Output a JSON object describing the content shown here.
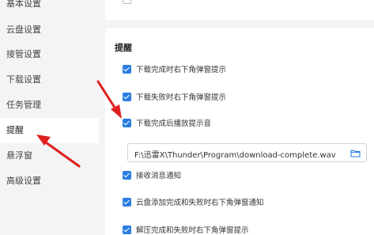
{
  "sidebar": {
    "items": [
      {
        "label": "基本设置"
      },
      {
        "label": "云盘设置"
      },
      {
        "label": "接管设置"
      },
      {
        "label": "下载设置"
      },
      {
        "label": "任务管理"
      },
      {
        "label": "提醒"
      },
      {
        "label": "悬浮窗"
      },
      {
        "label": "高级设置"
      }
    ],
    "active": "提醒"
  },
  "reminder": {
    "title": "提醒",
    "options": [
      {
        "label": "下载完成时右下角弹窗提示",
        "checked": true
      },
      {
        "label": "下载失败时右下角弹窗提示",
        "checked": true
      },
      {
        "label": "下载完成后播放提示音",
        "checked": true
      },
      {
        "label": "接收消息通知",
        "checked": true
      },
      {
        "label": "云盘添加完成和失败时右下角弹窗通知",
        "checked": true
      },
      {
        "label": "解压完成和失败时右下角弹窗提示",
        "checked": true
      }
    ],
    "sound_path": "F:\\迅雷X\\Thunder\\Program\\download-complete.wav"
  },
  "icons": {
    "folder": "folder-icon",
    "checkmark": "check-icon",
    "annotation": "red-arrow"
  },
  "colors": {
    "accent": "#2a7de1",
    "annotation": "#e02020",
    "sidebar_bg": "#f4f4f6",
    "panel_bg": "#ffffff"
  }
}
